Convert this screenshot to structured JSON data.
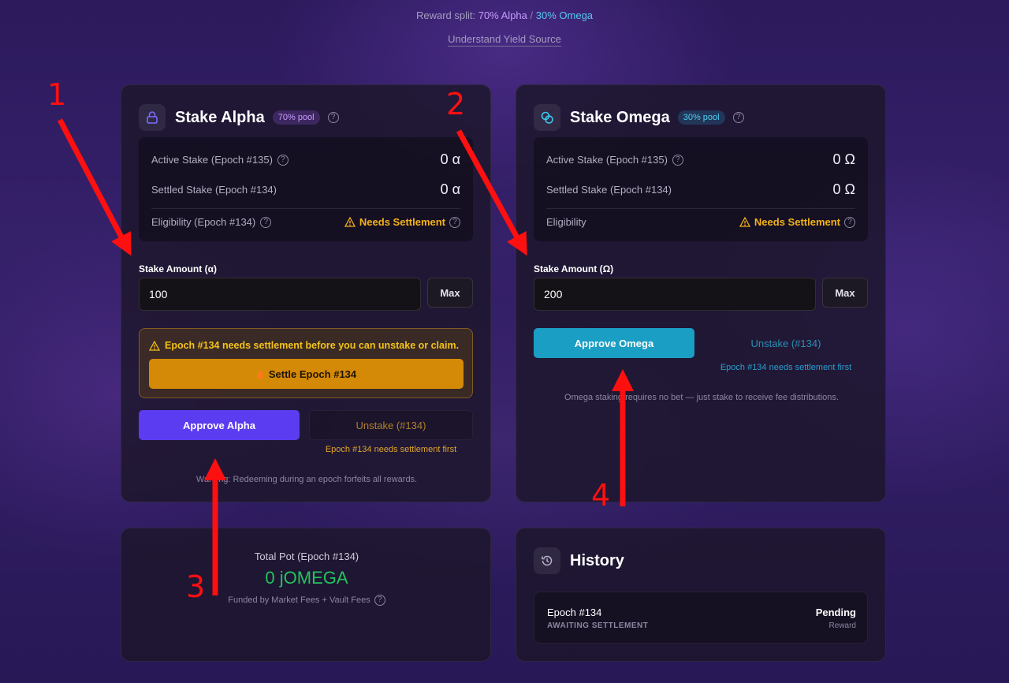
{
  "header": {
    "reward_split_prefix": "Reward split:",
    "reward_split_alpha": "70% Alpha",
    "reward_split_sep": "/",
    "reward_split_omega": "30% Omega",
    "yield_link": "Understand Yield Source"
  },
  "alpha": {
    "title": "Stake Alpha",
    "badge": "70% pool",
    "active_label": "Active Stake (Epoch #135)",
    "active_value": "0 α",
    "settled_label": "Settled Stake (Epoch #134)",
    "settled_value": "0 α",
    "eligibility_label": "Eligibility (Epoch #134)",
    "eligibility_value": "Needs Settlement",
    "amount_label": "Stake Amount (α)",
    "amount_value": "100",
    "max_label": "Max",
    "warning": "Epoch #134 needs settlement before you can unstake or claim.",
    "settle_label": "Settle Epoch #134",
    "approve_label": "Approve Alpha",
    "unstake_label": "Unstake (#134)",
    "settle_first": "Epoch #134 needs settlement first",
    "footnote": "Warning: Redeeming during an epoch forfeits all rewards."
  },
  "omega": {
    "title": "Stake Omega",
    "badge": "30% pool",
    "active_label": "Active Stake (Epoch #135)",
    "active_value": "0 Ω",
    "settled_label": "Settled Stake (Epoch #134)",
    "settled_value": "0 Ω",
    "eligibility_label": "Eligibility",
    "eligibility_value": "Needs Settlement",
    "amount_label": "Stake Amount (Ω)",
    "amount_value": "200",
    "max_label": "Max",
    "approve_label": "Approve Omega",
    "unstake_label": "Unstake (#134)",
    "settle_first": "Epoch #134 needs settlement first",
    "footnote": "Omega staking requires no bet — just stake to receive fee distributions."
  },
  "pot": {
    "label": "Total Pot (Epoch #134)",
    "value": "0 jOMEGA",
    "funded": "Funded by Market Fees + Vault Fees"
  },
  "history": {
    "title": "History",
    "epoch": "Epoch #134",
    "sub": "AWAITING SETTLEMENT",
    "status": "Pending",
    "type": "Reward"
  },
  "annotations": {
    "n1": "1",
    "n2": "2",
    "n3": "3",
    "n4": "4"
  },
  "colors": {
    "accent_alpha": "#5b3cf0",
    "accent_omega": "#1b9ec4",
    "warning": "#f3b21a",
    "settle_button": "#d48a06",
    "pot_green": "#22c55e",
    "annotation_red": "#ff1010"
  }
}
